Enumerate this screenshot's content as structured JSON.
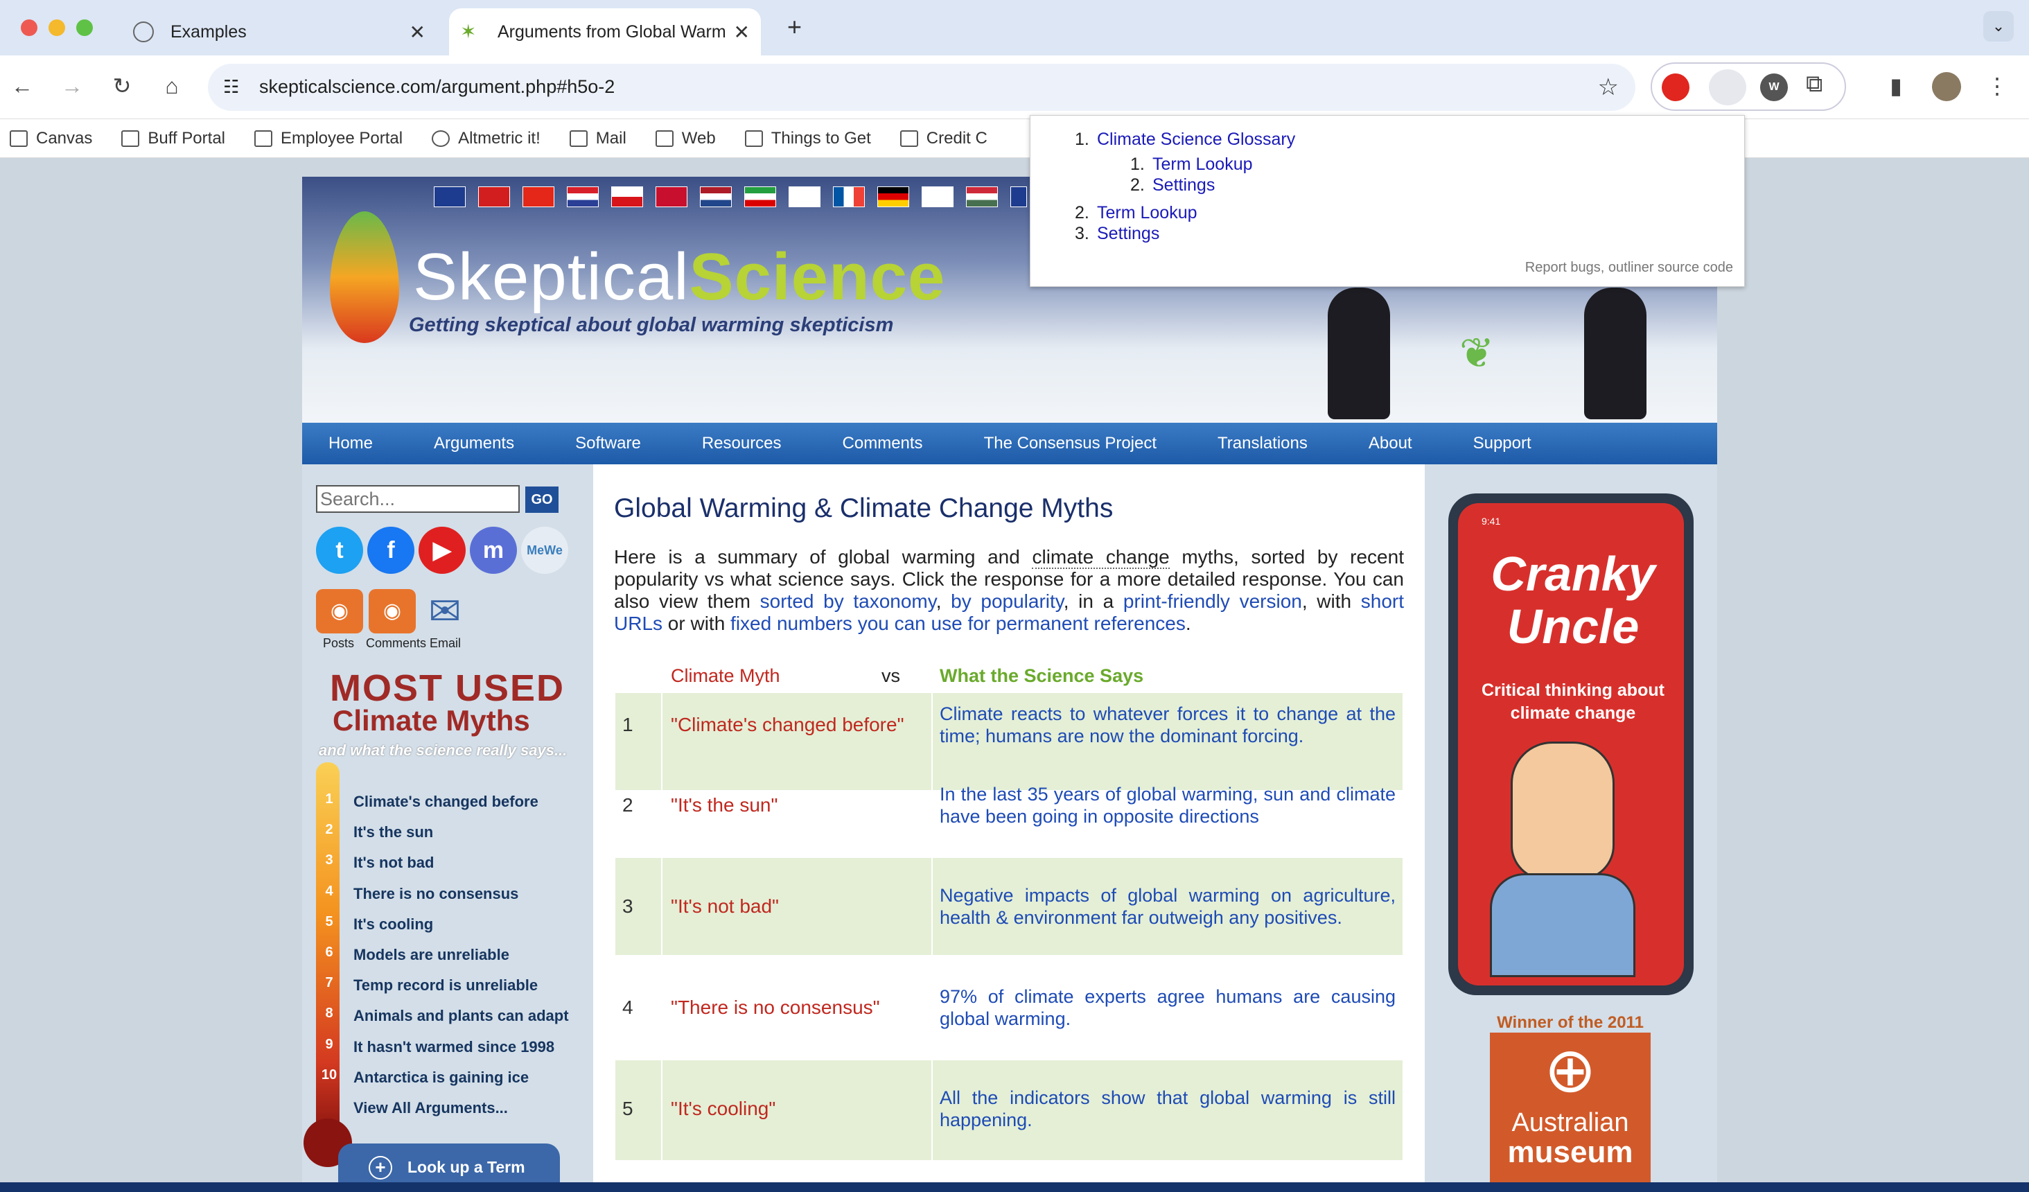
{
  "browser": {
    "tabs": [
      {
        "title": "Examples"
      },
      {
        "title": "Arguments from Global Warm"
      }
    ],
    "new_tab": "+",
    "url": "skepticalscience.com/argument.php#h5o-2",
    "bookmarks": [
      "Canvas",
      "Buff Portal",
      "Employee Portal",
      "Altmetric it!",
      "Mail",
      "Web",
      "Things to Get",
      "Credit C"
    ]
  },
  "outline_popup": {
    "items": [
      {
        "num": "1.",
        "label": "Climate Science Glossary"
      },
      {
        "num": "1.",
        "label": "Term Lookup"
      },
      {
        "num": "2.",
        "label": "Settings"
      },
      {
        "num": "2.",
        "label": "Term Lookup"
      },
      {
        "num": "3.",
        "label": "Settings"
      }
    ],
    "footer_a": "Report bugs",
    "footer_sep": ", ",
    "footer_b": "outliner source code"
  },
  "site": {
    "logo_a": "Skeptical",
    "logo_b": "Science",
    "tagline": "Getting skeptical about global warming skepticism",
    "nav": [
      "Home",
      "Arguments",
      "Software",
      "Resources",
      "Comments",
      "The Consensus Project",
      "Translations",
      "About",
      "Support"
    ],
    "search_placeholder": "Search...",
    "go_label": "GO",
    "social": [
      "Posts",
      "Comments",
      "Email"
    ],
    "most_used_1": "MOST USED",
    "most_used_2": "Climate Myths",
    "most_used_3": "and what the science really says...",
    "myths_list": [
      {
        "n": "1",
        "label": "Climate's changed before"
      },
      {
        "n": "2",
        "label": "It's the sun"
      },
      {
        "n": "3",
        "label": "It's not bad"
      },
      {
        "n": "4",
        "label": "There is no consensus"
      },
      {
        "n": "5",
        "label": "It's cooling"
      },
      {
        "n": "6",
        "label": "Models are unreliable"
      },
      {
        "n": "7",
        "label": "Temp record is unreliable"
      },
      {
        "n": "8",
        "label": "Animals and plants can adapt"
      },
      {
        "n": "9",
        "label": "It hasn't warmed since 1998"
      },
      {
        "n": "10",
        "label": "Antarctica is gaining ice"
      },
      {
        "n": "",
        "label": "View All Arguments..."
      }
    ],
    "lookup": "Look up a Term",
    "heading": "Global Warming & Climate Change Myths",
    "intro": {
      "p1": "Here is a summary of global warming and ",
      "l1": "climate change",
      "p2": " myths, sorted by recent popularity vs what science says. Click the response for a more detailed response. You can also view them ",
      "l2": "sorted by taxonomy",
      "p3": ", ",
      "l3": "by popularity",
      "p4": ", in a ",
      "l4": "print-friendly version",
      "p5": ", with ",
      "l5": "short URLs",
      "p6": " or with ",
      "l6": "fixed numbers you can use for permanent references",
      "p7": "."
    },
    "table_head": {
      "myth": "Climate Myth",
      "vs": "vs",
      "science": "What the Science Says"
    },
    "rows": [
      {
        "n": "1",
        "myth": "\"Climate's changed before\"",
        "science": "Climate reacts to whatever forces it to change at the time; humans are now the dominant forcing."
      },
      {
        "n": "2",
        "myth": "\"It's the sun\"",
        "science": "In the last 35 years of global warming, sun and climate have been going in opposite directions"
      },
      {
        "n": "3",
        "myth": "\"It's not bad\"",
        "science": "Negative impacts of global warming on agriculture, health & environment far outweigh any positives."
      },
      {
        "n": "4",
        "myth": "\"There is no consensus\"",
        "science": "97% of climate experts agree humans are causing global warming."
      },
      {
        "n": "5",
        "myth": "\"It's cooling\"",
        "science": "All the indicators show that global warming is still happening."
      }
    ],
    "ad": {
      "title": "Cranky Uncle",
      "sub": "Critical thinking about climate change",
      "time": "9:41",
      "winner": "Winner of the 2011",
      "museum_1": "Australian",
      "museum_2": "museum"
    }
  }
}
